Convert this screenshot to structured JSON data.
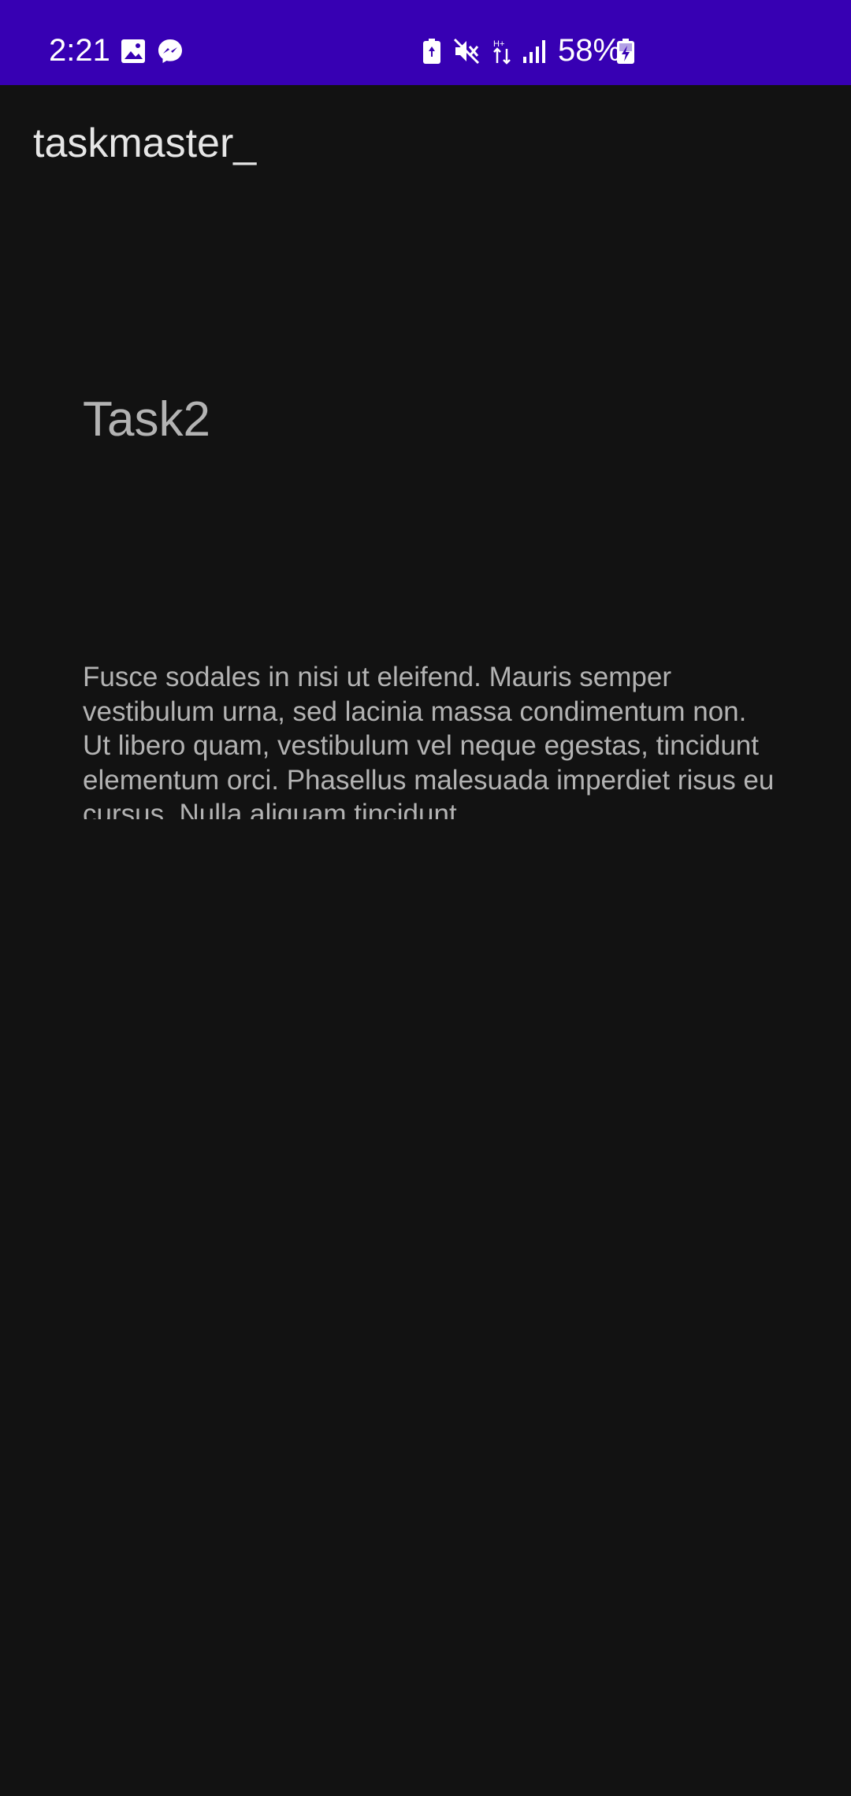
{
  "status_bar": {
    "time": "2:21",
    "battery": "58%",
    "background_color": "#3700b3",
    "icons": [
      "gallery-icon",
      "messenger-icon",
      "battery-saver-icon",
      "mute-icon",
      "data-transfer-icon",
      "signal-icon",
      "battery-charging-icon"
    ]
  },
  "app_bar": {
    "title": "taskmaster_"
  },
  "task": {
    "title": "Task2",
    "body": "Fusce sodales in nisi ut eleifend. Mauris semper vestibulum urna, sed lacinia massa condimentum non. Ut libero quam, vestibulum vel neque egestas, tincidunt elementum orci. Phasellus malesuada imperdiet risus eu cursus. Nulla aliquam tincidunt"
  },
  "theme": {
    "background": "#121212",
    "text_primary": "#e6e6e6",
    "text_secondary": "#b3b3b3"
  }
}
